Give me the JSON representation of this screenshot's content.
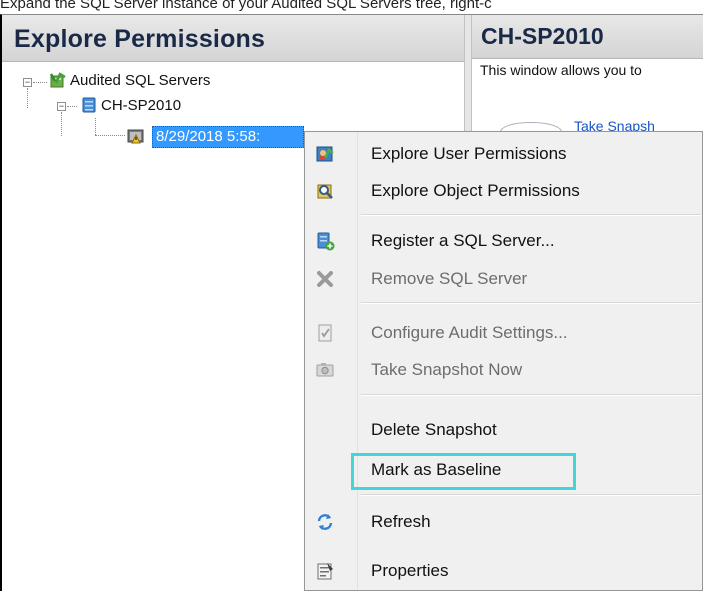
{
  "caption": "Expand the SQL Server instance of your Audited SQL Servers tree, right-c",
  "left_panel": {
    "title": "Explore Permissions",
    "tree": {
      "root_label": "Audited SQL Servers",
      "server_label": "CH-SP2010",
      "snapshot_label": "8/29/2018 5:58:"
    }
  },
  "right_panel": {
    "title": "CH-SP2010",
    "description": "This window allows you to",
    "partial_link": "Take Snapsh"
  },
  "context_menu": {
    "items": [
      {
        "label": "Explore User Permissions",
        "icon": "user-permissions-icon",
        "enabled": true
      },
      {
        "label": "Explore Object Permissions",
        "icon": "object-permissions-icon",
        "enabled": true
      },
      {
        "label": "Register a SQL Server...",
        "icon": "register-server-icon",
        "enabled": true
      },
      {
        "label": "Remove SQL Server",
        "icon": "remove-server-icon",
        "enabled": false
      },
      {
        "label": "Configure Audit Settings...",
        "icon": "audit-settings-icon",
        "enabled": false
      },
      {
        "label": "Take Snapshot Now",
        "icon": "camera-icon",
        "enabled": false
      },
      {
        "label": "Delete Snapshot",
        "icon": "",
        "enabled": true
      },
      {
        "label": "Mark as Baseline",
        "icon": "",
        "enabled": true,
        "highlighted": true
      },
      {
        "label": "Refresh",
        "icon": "refresh-icon",
        "enabled": true
      },
      {
        "label": "Properties",
        "icon": "properties-icon",
        "enabled": true
      }
    ]
  },
  "colors": {
    "selection": "#3399ff",
    "highlight_box": "#42d6d6",
    "title_text": "#1a2a46"
  }
}
